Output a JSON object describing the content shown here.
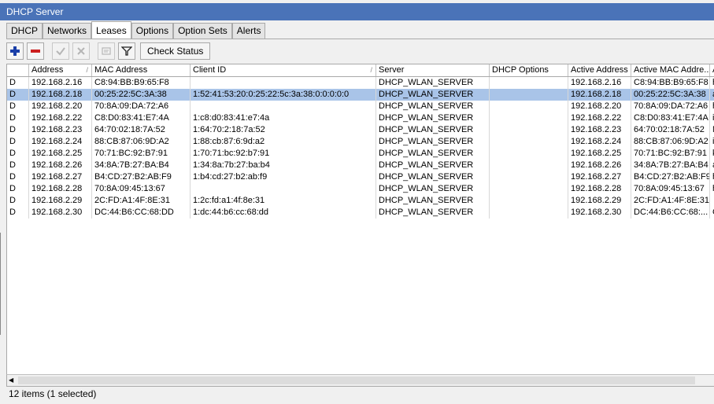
{
  "window": {
    "title": "DHCP Server"
  },
  "tabs": [
    {
      "label": "DHCP",
      "active": false
    },
    {
      "label": "Networks",
      "active": false
    },
    {
      "label": "Leases",
      "active": true
    },
    {
      "label": "Options",
      "active": false
    },
    {
      "label": "Option Sets",
      "active": false
    },
    {
      "label": "Alerts",
      "active": false
    }
  ],
  "toolbar": {
    "icons": [
      "add-icon",
      "remove-icon",
      "enable-icon",
      "disable-icon",
      "comment-icon",
      "filter-icon"
    ],
    "check_status_label": "Check Status",
    "colors": {
      "add": "#1a3fa8",
      "remove": "#cc1e1e"
    }
  },
  "table": {
    "columns": [
      "",
      "Address",
      "MAC Address",
      "Client ID",
      "Server",
      "DHCP Options",
      "Active Address",
      "Active MAC Addre...",
      "A"
    ],
    "rows": [
      [
        "D",
        "192.168.2.16",
        "C8:94:BB:B9:65:F8",
        "",
        "DHCP_WLAN_SERVER",
        "",
        "192.168.2.16",
        "C8:94:BB:B9:65:F8",
        "h"
      ],
      [
        "D",
        "192.168.2.18",
        "00:25:22:5C:3A:38",
        "1:52:41:53:20:0:25:22:5c:3a:38:0:0:0:0:0",
        "DHCP_WLAN_SERVER",
        "",
        "192.168.2.18",
        "00:25:22:5C:3A:38",
        "a"
      ],
      [
        "D",
        "192.168.2.20",
        "70:8A:09:DA:72:A6",
        "",
        "DHCP_WLAN_SERVER",
        "",
        "192.168.2.20",
        "70:8A:09:DA:72:A6",
        "h"
      ],
      [
        "D",
        "192.168.2.22",
        "C8:D0:83:41:E7:4A",
        "1:c8:d0:83:41:e7:4a",
        "DHCP_WLAN_SERVER",
        "",
        "192.168.2.22",
        "C8:D0:83:41:E7:4A",
        "i"
      ],
      [
        "D",
        "192.168.2.23",
        "64:70:02:18:7A:52",
        "1:64:70:2:18:7a:52",
        "DHCP_WLAN_SERVER",
        "",
        "192.168.2.23",
        "64:70:02:18:7A:52",
        "N"
      ],
      [
        "D",
        "192.168.2.24",
        "88:CB:87:06:9D:A2",
        "1:88:cb:87:6:9d:a2",
        "DHCP_WLAN_SERVER",
        "",
        "192.168.2.24",
        "88:CB:87:06:9D:A2",
        "i"
      ],
      [
        "D",
        "192.168.2.25",
        "70:71:BC:92:B7:91",
        "1:70:71:bc:92:b7:91",
        "DHCP_WLAN_SERVER",
        "",
        "192.168.2.25",
        "70:71:BC:92:B7:91",
        "k"
      ],
      [
        "D",
        "192.168.2.26",
        "34:8A:7B:27:BA:B4",
        "1:34:8a:7b:27:ba:b4",
        "DHCP_WLAN_SERVER",
        "",
        "192.168.2.26",
        "34:8A:7B:27:BA:B4",
        "a"
      ],
      [
        "D",
        "192.168.2.27",
        "B4:CD:27:B2:AB:F9",
        "1:b4:cd:27:b2:ab:f9",
        "DHCP_WLAN_SERVER",
        "",
        "192.168.2.27",
        "B4:CD:27:B2:AB:F9",
        "h"
      ],
      [
        "D",
        "192.168.2.28",
        "70:8A:09:45:13:67",
        "",
        "DHCP_WLAN_SERVER",
        "",
        "192.168.2.28",
        "70:8A:09:45:13:67",
        "h"
      ],
      [
        "D",
        "192.168.2.29",
        "2C:FD:A1:4F:8E:31",
        "1:2c:fd:a1:4f:8e:31",
        "DHCP_WLAN_SERVER",
        "",
        "192.168.2.29",
        "2C:FD:A1:4F:8E:31",
        ""
      ],
      [
        "D",
        "192.168.2.30",
        "DC:44:B6:CC:68:DD",
        "1:dc:44:b6:cc:68:dd",
        "DHCP_WLAN_SERVER",
        "",
        "192.168.2.30",
        "DC:44:B6:CC:68:...",
        "G"
      ]
    ],
    "selected_row": 1
  },
  "status": {
    "text": "12 items (1 selected)"
  }
}
